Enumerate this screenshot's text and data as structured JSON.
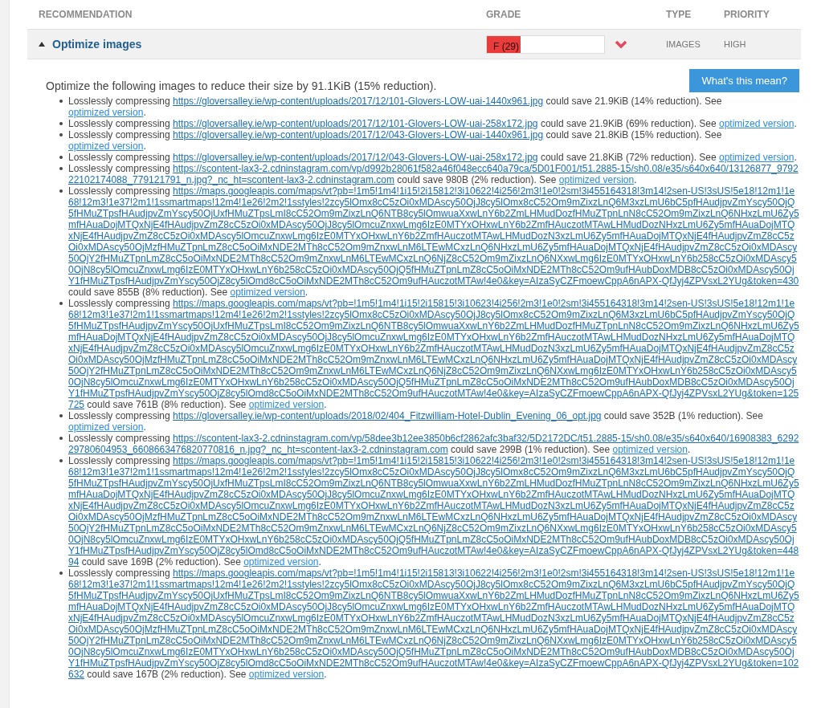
{
  "table": {
    "columns": [
      "RECOMMENDATION",
      "GRADE",
      "TYPE",
      "PRIORITY"
    ],
    "row": {
      "title": "Optimize images",
      "expanded": true,
      "grade": {
        "label": "F (29)",
        "level": 0.29
      },
      "type": "IMAGES",
      "priority": "HIGH"
    }
  },
  "details": {
    "summary": "Optimize the following images to reduce their size by 91.1KiB (15% reduction).",
    "button": "What's this mean?",
    "items": [
      {
        "lead": "Losslessly compressing",
        "url": "https://gloversalley.ie/wp-content/uploads/2017/12/101-Glovers-LOW-uai-1440x961.jpg",
        "saving": "could save 21.9KiB (14% reduction). See",
        "link": "optimized version",
        "end": "."
      },
      {
        "lead": "Losslessly compressing",
        "url": "https://gloversalley.ie/wp-content/uploads/2017/12/101-Glovers-LOW-uai-258x172.jpg",
        "saving": "could save 21.9KiB (69% reduction). See",
        "link": "optimized version",
        "end": "."
      },
      {
        "lead": "Losslessly compressing",
        "url": "https://gloversalley.ie/wp-content/uploads/2017/12/043-Glovers-LOW-uai-1440x961.jpg",
        "saving": "could save 21.8KiB (15% reduction). See",
        "link": "optimized version",
        "end": "."
      },
      {
        "lead": "Losslessly compressing",
        "url": "https://gloversalley.ie/wp-content/uploads/2017/12/043-Glovers-LOW-uai-258x172.jpg",
        "saving": "could save 21.8KiB (72% reduction). See",
        "link": "optimized version",
        "end": "."
      },
      {
        "lead": "Losslessly compressing",
        "url": "https://scontent-lax3-2.cdninstagram.com/vp/d992b28061f582a46f048ecc640a79ca/5D01F001/t51.2885-15/sh0.08/e35/s640x640/13126877_979222102174088_779121791_n.jpg?_nc_ht=scontent-lax3-2.cdninstagram.com",
        "saving": "could save 980B (2% reduction). See",
        "link": "optimized version",
        "end": "."
      },
      {
        "lead": "Losslessly compressing",
        "url": "https://maps.googleapis.com/maps/vt?pb=!1m5!1m4!1i15!2i15812!3i10622!4i256!2m3!1e0!2sm!3i455164318!3m14!2sen-US!3sUS!5e18!12m1!1e68!12m3!1e37!2m1!1ssmartmaps!12m4!1e26!2m2!1sstyles!2zcy5lOmx8cC5zOi0xMDAscy50OjJ8cy5lOmx8cC52Om9mZixzLnQ6M3xzLmU6bC5pfHAudjpvZmYscy50OjQ5fHMuZTpsfHAudjpvZmYscy50OjUxfHMuZTpsLmI8cC52Om9mZixzLnQ6NTB8cy5lOmwuaXxwLnY6b2ZmLHMudDozfHMuZTpnLnN8cC52Om9mZixzLnQ6NHxzLmU6Zy5mfHAuaDojMTQxNjE4fHAudjpvZmZ8cC5zOi0xMDAscy50OjJ8cy5lOmcuZnxwLmg6IzE0MTYxOHxwLnY6b2ZmfHAuczotMTAwLHMudDozNHxzLmU6Zy5mfHAuaDojMTQxNjE4fHAudjpvZmZ8cC5zOi0xMDAscy5lOmcuZnxwLmg6IzE0MTYxOHxwLnY6b2ZmfHAuczotMTAwLHMudDozN3xzLmU6Zy5mfHAuaDojMTQxNjE4fHAudjpvZmZ8cC5zOi0xMDAscy50OjMzfHMuZTpnLmZ8cC5oOiMxNDE2MTh8cC52Om9mZnxwLnM6LTEwMCxzLnQ6NHxzLmU6Zy5mfHAuaDojMTQxNjE4fHAudjpvZmZ8cC5zOi0xMDAscy50OjY2fHMuZTpnLmZ8cC5oOiMxNDE2MTh8cC52Om9mZnxwLnM6LTEwMCxzLnQ6NjZ8cC52Om9mZixzLnQ6NXxwLmg6IzE0MTYxOHxwLnY6b258cC5zOi0xMDAscy50OjN8cy5lOmcuZnxwLmg6IzE0MTYxOHxwLnY6b258cC5zOi0xMDAscy50OjQ5fHMuZTpnLmZ8cC5oOiMxNDE2MTh8cC52Om9ufHAubDoxMDB8cC5zOi0xMDAscy50OjY1fHMuZTpsfHAudjpvZmYscy50OjZ8cy5lOmd8cC5oOiMxNDE2MTh8cC52Om9ufHAuczotMTAw!4e0&key=AIzaSyCZFmoewCppA6nAPX-QfJyj4ZPVsxL2YUg&token=430",
        "saving": "could save 855B (8% reduction). See",
        "link": "optimized version",
        "end": "."
      },
      {
        "lead": "Losslessly compressing",
        "url": "https://maps.googleapis.com/maps/vt?pb=!1m5!1m4!1i15!2i15815!3i10623!4i256!2m3!1e0!2sm!3i455164318!3m14!2sen-US!3sUS!5e18!12m1!1e68!12m3!1e37!2m1!1ssmartmaps!12m4!1e26!2m2!1sstyles!2zcy5lOmx8cC5zOi0xMDAscy50OjJ8cy5lOmx8cC52Om9mZixzLnQ6M3xzLmU6bC5pfHAudjpvZmYscy50OjQ5fHMuZTpsfHAudjpvZmYscy50OjUxfHMuZTpsLmI8cC52Om9mZixzLnQ6NTB8cy5lOmwuaXxwLnY6b2ZmLHMudDozfHMuZTpnLnN8cC52Om9mZixzLnQ6NHxzLmU6Zy5mfHAuaDojMTQxNjE4fHAudjpvZmZ8cC5zOi0xMDAscy50OjJ8cy5lOmcuZnxwLmg6IzE0MTYxOHxwLnY6b2ZmfHAuczotMTAwLHMudDozNHxzLmU6Zy5mfHAuaDojMTQxNjE4fHAudjpvZmZ8cC5zOi0xMDAscy5lOmcuZnxwLmg6IzE0MTYxOHxwLnY6b2ZmfHAuczotMTAwLHMudDozN3xzLmU6Zy5mfHAuaDojMTQxNjE4fHAudjpvZmZ8cC5zOi0xMDAscy50OjMzfHMuZTpnLmZ8cC5oOiMxNDE2MTh8cC52Om9mZnxwLnM6LTEwMCxzLnQ6NHxzLmU6Zy5mfHAuaDojMTQxNjE4fHAudjpvZmZ8cC5zOi0xMDAscy50OjY2fHMuZTpnLmZ8cC5oOiMxNDE2MTh8cC52Om9mZnxwLnM6LTEwMCxzLnQ6NjZ8cC52Om9mZixzLnQ6NXxwLmg6IzE0MTYxOHxwLnY6b258cC5zOi0xMDAscy50OjN8cy5lOmcuZnxwLmg6IzE0MTYxOHxwLnY6b258cC5zOi0xMDAscy50OjQ5fHMuZTpnLmZ8cC5oOiMxNDE2MTh8cC52Om9ufHAubDoxMDB8cC5zOi0xMDAscy50OjY1fHMuZTpsfHAudjpvZmYscy50OjZ8cy5lOmd8cC5oOiMxNDE2MTh8cC52Om9ufHAuczotMTAw!4e0&key=AIzaSyCZFmoewCppA6nAPX-QfJyj4ZPVsxL2YUg&token=125725",
        "saving": "could save 761B (8% reduction). See",
        "link": "optimized version",
        "end": "."
      },
      {
        "lead": "Losslessly compressing",
        "url": "https://gloversalley.ie/wp-content/uploads/2018/02/404_Fitzwilliam-Hotel-Dublin_Evening_06_opt.jpg",
        "saving": "could save 352B (1% reduction). See",
        "link": "optimized version",
        "end": "."
      },
      {
        "lead": "Losslessly compressing",
        "url": "https://scontent-lax3-2.cdninstagram.com/vp/58dee3b12ee3850b6cf2862afc3baf32/5D2172DC/t51.2885-15/sh0.08/e35/s640x640/16908383_629229780604953_6608663476820770816_n.jpg?_nc_ht=scontent-lax3-2.cdninstagram.com",
        "saving": "could save 299B (1% reduction). See",
        "link": "optimized version",
        "end": "."
      },
      {
        "lead": "Losslessly compressing",
        "url": "https://maps.googleapis.com/maps/vt?pb=!1m5!1m4!1i15!2i15815!3i10622!4i256!2m3!1e0!2sm!3i455164318!3m14!2sen-US!3sUS!5e18!12m1!1e68!12m3!1e37!2m1!1ssmartmaps!12m4!1e26!2m2!1sstyles!2zcy5lOmx8cC5zOi0xMDAscy50OjJ8cy5lOmx8cC52Om9mZixzLnQ6M3xzLmU6bC5pfHAudjpvZmYscy50OjQ5fHMuZTpsfHAudjpvZmYscy50OjUxfHMuZTpsLmI8cC52Om9mZixzLnQ6NTB8cy5lOmwuaXxwLnY6b2ZmLHMudDozfHMuZTpnLnN8cC52Om9mZixzLnQ6NHxzLmU6Zy5mfHAuaDojMTQxNjE4fHAudjpvZmZ8cC5zOi0xMDAscy50OjJ8cy5lOmcuZnxwLmg6IzE0MTYxOHxwLnY6b2ZmfHAuczotMTAwLHMudDozNHxzLmU6Zy5mfHAuaDojMTQxNjE4fHAudjpvZmZ8cC5zOi0xMDAscy5lOmcuZnxwLmg6IzE0MTYxOHxwLnY6b2ZmfHAuczotMTAwLHMudDozN3xzLmU6Zy5mfHAuaDojMTQxNjE4fHAudjpvZmZ8cC5zOi0xMDAscy50OjMzfHMuZTpnLmZ8cC5oOiMxNDE2MTh8cC52Om9mZnxwLnM6LTEwMCxzLnQ6NHxzLmU6Zy5mfHAuaDojMTQxNjE4fHAudjpvZmZ8cC5zOi0xMDAscy50OjY2fHMuZTpnLmZ8cC5oOiMxNDE2MTh8cC52Om9mZnxwLnM6LTEwMCxzLnQ6NjZ8cC52Om9mZixzLnQ6NXxwLmg6IzE0MTYxOHxwLnY6b258cC5zOi0xMDAscy50OjN8cy5lOmcuZnxwLmg6IzE0MTYxOHxwLnY6b258cC5zOi0xMDAscy50OjQ5fHMuZTpnLmZ8cC5oOiMxNDE2MTh8cC52Om9ufHAubDoxMDB8cC5zOi0xMDAscy50OjY1fHMuZTpsfHAudjpvZmYscy50OjZ8cy5lOmd8cC5oOiMxNDE2MTh8cC52Om9ufHAuczotMTAw!4e0&key=AIzaSyCZFmoewCppA6nAPX-QfJyj4ZPVsxL2YUg&token=44894",
        "saving": "could save 169B (2% reduction). See",
        "link": "optimized version",
        "end": "."
      },
      {
        "lead": "Losslessly compressing",
        "url": "https://maps.googleapis.com/maps/vt?pb=!1m5!1m4!1i15!2i15813!3i10622!4i256!2m3!1e0!2sm!3i455164318!3m14!2sen-US!3sUS!5e18!12m1!1e68!12m3!1e37!2m1!1ssmartmaps!12m4!1e26!2m2!1sstyles!2zcy5lOmx8cC5zOi0xMDAscy50OjJ8cy5lOmx8cC52Om9mZixzLnQ6M3xzLmU6bC5pfHAudjpvZmYscy50OjQ5fHMuZTpsfHAudjpvZmYscy50OjUxfHMuZTpsLmI8cC52Om9mZixzLnQ6NTB8cy5lOmwuaXxwLnY6b2ZmLHMudDozfHMuZTpnLnN8cC52Om9mZixzLnQ6NHxzLmU6Zy5mfHAuaDojMTQxNjE4fHAudjpvZmZ8cC5zOi0xMDAscy50OjJ8cy5lOmcuZnxwLmg6IzE0MTYxOHxwLnY6b2ZmfHAuczotMTAwLHMudDozNHxzLmU6Zy5mfHAuaDojMTQxNjE4fHAudjpvZmZ8cC5zOi0xMDAscy5lOmcuZnxwLmg6IzE0MTYxOHxwLnY6b2ZmfHAuczotMTAwLHMudDozN3xzLmU6Zy5mfHAuaDojMTQxNjE4fHAudjpvZmZ8cC5zOi0xMDAscy50OjMzfHMuZTpnLmZ8cC5oOiMxNDE2MTh8cC52Om9mZnxwLnM6LTEwMCxzLnQ6NHxzLmU6Zy5mfHAuaDojMTQxNjE4fHAudjpvZmZ8cC5zOi0xMDAscy50OjY2fHMuZTpnLmZ8cC5oOiMxNDE2MTh8cC52Om9mZnxwLnM6LTEwMCxzLnQ6NjZ8cC52Om9mZixzLnQ6NXxwLmg6IzE0MTYxOHxwLnY6b258cC5zOi0xMDAscy50OjN8cy5lOmcuZnxwLmg6IzE0MTYxOHxwLnY6b258cC5zOi0xMDAscy50OjQ5fHMuZTpnLmZ8cC5oOiMxNDE2MTh8cC52Om9ufHAubDoxMDB8cC5zOi0xMDAscy50OjY1fHMuZTpsfHAudjpvZmYscy50OjZ8cy5lOmd8cC5oOiMxNDE2MTh8cC52Om9ufHAuczotMTAw!4e0&key=AIzaSyCZFmoewCppA6nAPX-QfJyj4ZPVsxL2YUg&token=102632",
        "saving": "could save 167B (2% reduction). See",
        "link": "optimized version",
        "end": "."
      }
    ]
  }
}
